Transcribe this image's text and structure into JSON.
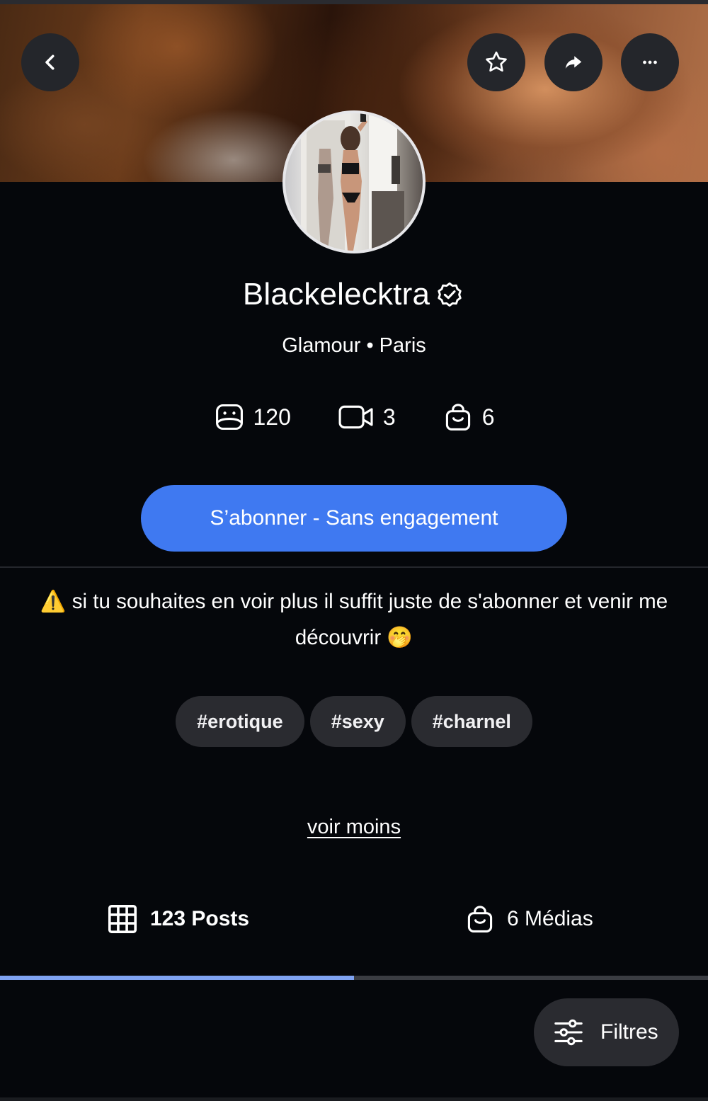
{
  "header": {
    "back_icon": "chevron-left-icon",
    "favorite_icon": "star-icon",
    "share_icon": "share-arrow-icon",
    "more_icon": "more-horizontal-icon"
  },
  "profile": {
    "username": "Blackelecktra",
    "verified_icon": "verified-badge-icon",
    "subtitle": "Glamour • Paris"
  },
  "stats": [
    {
      "icon": "photo-icon",
      "value": "120"
    },
    {
      "icon": "video-icon",
      "value": "3"
    },
    {
      "icon": "shopping-bag-icon",
      "value": "6"
    }
  ],
  "subscribe_label": "S’abonner - Sans engagement",
  "bio": {
    "warning_emoji": "⚠️",
    "text": "si tu souhaites en voir plus il suffit juste de s'abonner et venir me découvrir",
    "end_emoji": "🤭"
  },
  "tags": [
    "#erotique",
    "#sexy",
    "#charnel"
  ],
  "see_less_label": "voir moins",
  "tabs": [
    {
      "label": "123 Posts",
      "icon": "grid-icon",
      "active": true
    },
    {
      "label": "6 Médias",
      "icon": "shopping-bag-icon",
      "active": false
    }
  ],
  "filters_label": "Filtres",
  "colors": {
    "background": "#05070b",
    "accent": "#3f79f1",
    "tab_indicator": "#7fa3f2",
    "chip": "#2a2b30"
  }
}
